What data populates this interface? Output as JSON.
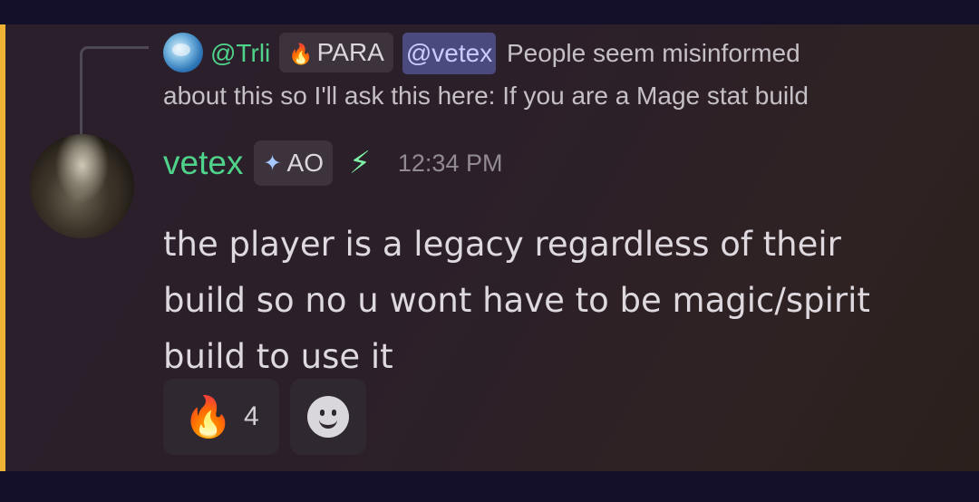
{
  "reply": {
    "username": "@Trli",
    "tag": "PARA",
    "mention": "@vetex",
    "text_line1": "People seem misinformed",
    "text_line2": "about this so I'll ask this here: If you are a Mage stat build"
  },
  "message": {
    "author": "vetex",
    "tag": "AO",
    "timestamp": "12:34 PM",
    "lines": [
      "the player is a legacy regardless of their",
      "build so no u wont have to be magic/spirit",
      "build to use it"
    ]
  },
  "reactions": [
    {
      "emoji": "🔥",
      "count": "4"
    }
  ],
  "colors": {
    "username": "#4fd38a",
    "highlight_bar": "#f0b232",
    "mention_bg": "#4b4a7e"
  }
}
